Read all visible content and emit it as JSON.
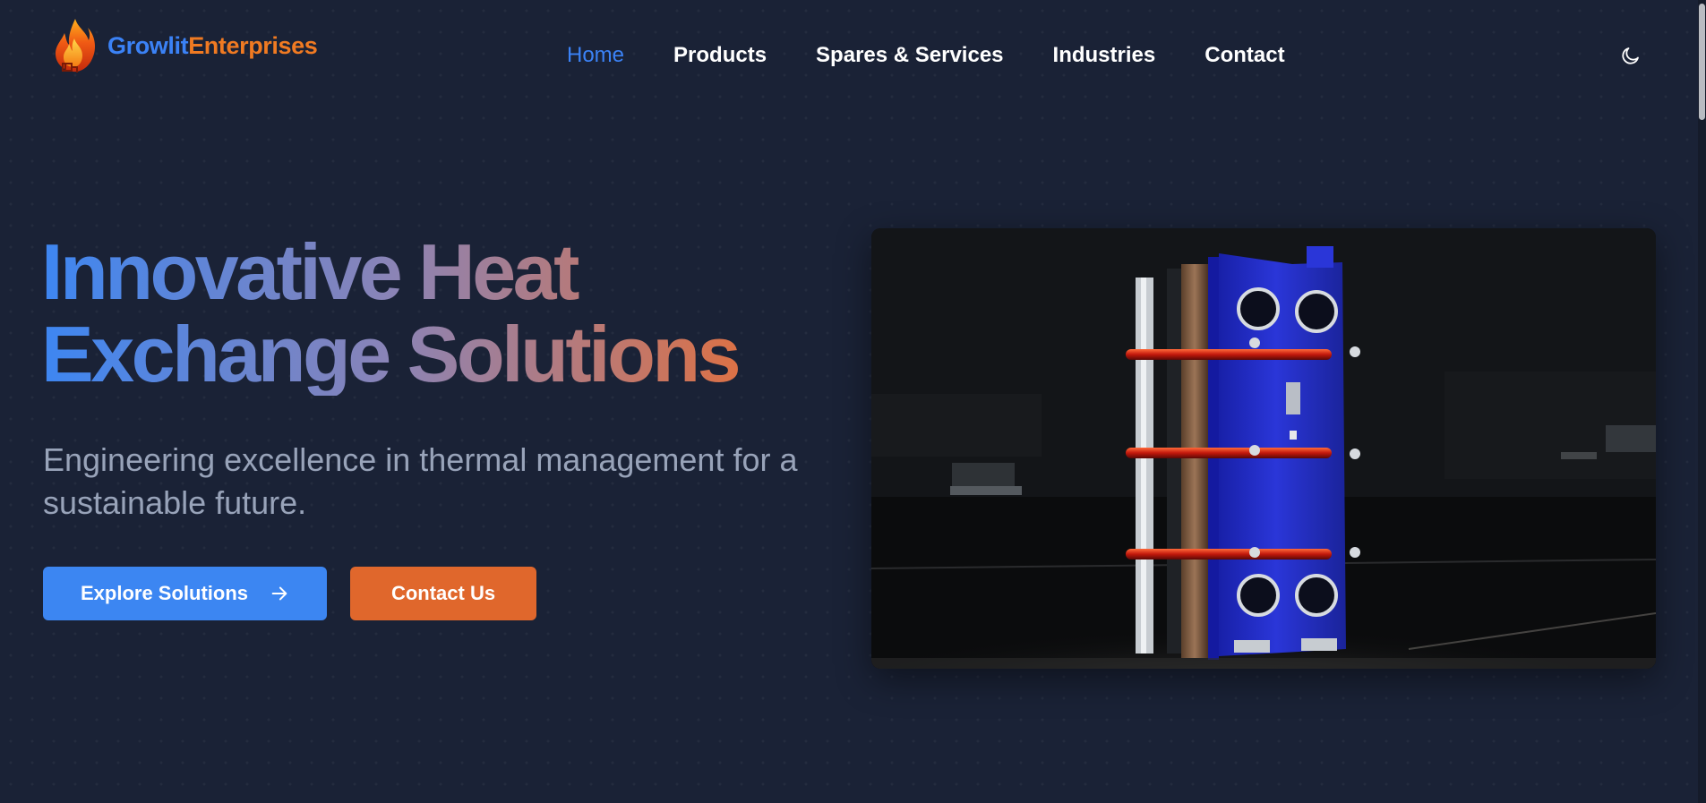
{
  "brand": {
    "part_one": "Growlit",
    "part_two": "Enterprises",
    "logo_icon": "flame-logo-icon",
    "colors": {
      "primary": "#3b82f6",
      "accent": "#f07a22"
    }
  },
  "nav": {
    "items": [
      {
        "label": "Home",
        "active": true
      },
      {
        "label": "Products",
        "active": false
      },
      {
        "label": "Spares & Services",
        "active": false
      },
      {
        "label": "Industries",
        "active": false
      },
      {
        "label": "Contact",
        "active": false
      }
    ],
    "theme_toggle_icon": "moon-icon"
  },
  "hero": {
    "title_line_1": "Innovative Heat",
    "title_line_2": "Exchange Solutions",
    "subtitle": "Engineering excellence in thermal management for a sustainable future.",
    "primary_button": {
      "label": "Explore Solutions",
      "icon": "arrow-right-icon"
    },
    "secondary_button": {
      "label": "Contact Us"
    },
    "image_subject": "plate-heat-exchanger-photo"
  },
  "theme": {
    "background": "#1a2236",
    "title_gradient": [
      "#3d86f2",
      "#8b84b6",
      "#e46f3a"
    ],
    "subtitle_color": "#98a3b9",
    "primary_button_color": "#3c86f2",
    "secondary_button_color": "#e0672c"
  }
}
